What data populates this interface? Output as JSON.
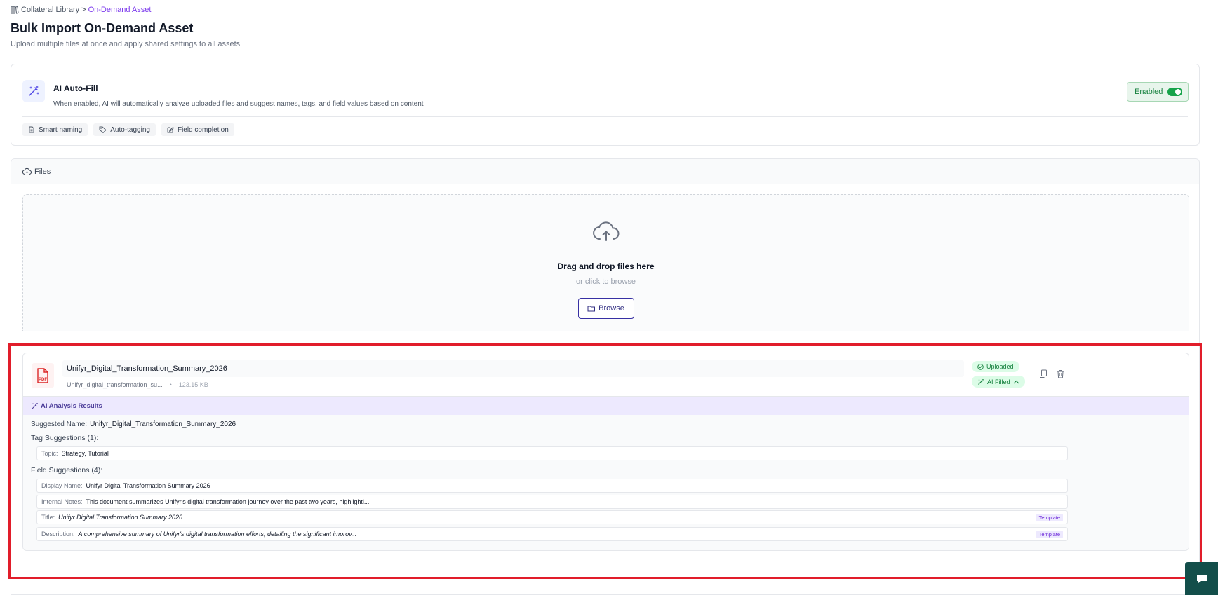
{
  "breadcrumb": {
    "parent": "Collateral Library",
    "separator": ">",
    "current": "On-Demand Asset"
  },
  "header": {
    "title": "Bulk Import On-Demand Asset",
    "subtitle": "Upload multiple files at once and apply shared settings to all assets"
  },
  "ai_autofill": {
    "icon": "magic-wand-icon",
    "title": "AI Auto-Fill",
    "description": "When enabled, AI will automatically analyze uploaded files and suggest names, tags, and field values based on content",
    "toggle_label": "Enabled",
    "toggle_on": true,
    "features": [
      {
        "icon": "document-icon",
        "label": "Smart naming"
      },
      {
        "icon": "tag-icon",
        "label": "Auto-tagging"
      },
      {
        "icon": "edit-icon",
        "label": "Field completion"
      }
    ]
  },
  "files": {
    "header_label": "Files",
    "dropzone": {
      "title": "Drag and drop files here",
      "subtitle": "or click to browse",
      "browse_label": "Browse"
    },
    "items": [
      {
        "type_label": "PDF",
        "name_value": "Unifyr_Digital_Transformation_Summary_2026",
        "original_filename": "Unifyr_digital_transformation_su...",
        "meta_separator": "•",
        "size": "123.15 KB",
        "status_badge": "Uploaded",
        "ai_badge": "AI Filled",
        "analysis": {
          "header": "AI Analysis Results",
          "suggested_name_label": "Suggested Name:",
          "suggested_name": "Unifyr_Digital_Transformation_Summary_2026",
          "tag_suggestions_label": "Tag Suggestions (1):",
          "tags": [
            {
              "key": "Topic:",
              "value": "Strategy, Tutorial"
            }
          ],
          "field_suggestions_label": "Field Suggestions (4):",
          "fields": [
            {
              "key": "Display Name:",
              "value": "Unifyr Digital Transformation Summary 2026",
              "italic": false,
              "badge": ""
            },
            {
              "key": "Internal Notes:",
              "value": "This document summarizes Unifyr's digital transformation journey over the past two years, highlighti...",
              "italic": false,
              "badge": ""
            },
            {
              "key": "Title:",
              "value": "Unifyr Digital Transformation Summary 2026",
              "italic": true,
              "badge": "Template"
            },
            {
              "key": "Description:",
              "value": "A comprehensive summary of Unifyr's digital transformation efforts, detailing the significant improv...",
              "italic": true,
              "badge": "Template"
            }
          ]
        }
      }
    ]
  },
  "colors": {
    "accent": "#7c3aed",
    "success": "#16a34a",
    "highlight": "#e11d2a",
    "chat": "#134e4a"
  }
}
